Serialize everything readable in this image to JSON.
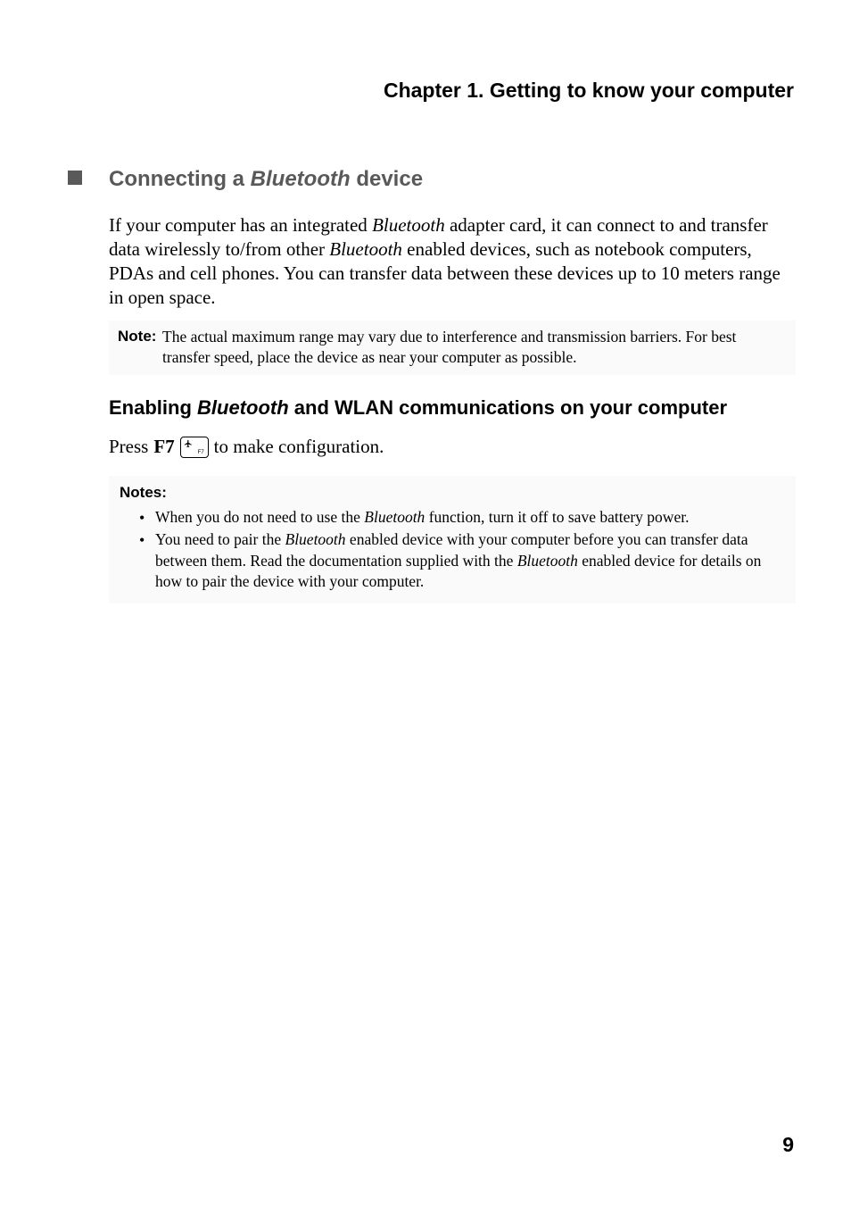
{
  "chapter_title": "Chapter 1. Getting to know your computer",
  "section": {
    "heading_pre": "Connecting a ",
    "heading_italic": "Bluetooth",
    "heading_post": " device",
    "body_1a": "If your computer has an integrated ",
    "body_1b": "Bluetooth",
    "body_1c": " adapter card, it can connect to and transfer data wirelessly to/from other ",
    "body_1d": "Bluetooth",
    "body_1e": " enabled devices, such as notebook computers, PDAs and cell phones. You can transfer data between these devices up to 10 meters range in open space.",
    "note_label": "Note:",
    "note_text": "The actual maximum range may vary due to interference and transmission barriers. For best transfer speed, place the device as near your computer as possible.",
    "sub_heading_pre": "Enabling ",
    "sub_heading_italic": "Bluetooth",
    "sub_heading_post": " and WLAN communications on your computer",
    "instr_pre": "Press ",
    "instr_key": "F7",
    "instr_keysub": "F7",
    "instr_post": " to make configuration.",
    "notes_label": "Notes:",
    "notes": {
      "n1a": "When you do not need to use the ",
      "n1b": "Bluetooth",
      "n1c": " function, turn it off to save battery power.",
      "n2a": "You need to pair the ",
      "n2b": "Bluetooth",
      "n2c": " enabled device with your computer before you can transfer data between them. Read the documentation supplied with the ",
      "n2d": "Bluetooth",
      "n2e": " enabled device for details on how to pair the device with your computer."
    }
  },
  "page_number": "9"
}
